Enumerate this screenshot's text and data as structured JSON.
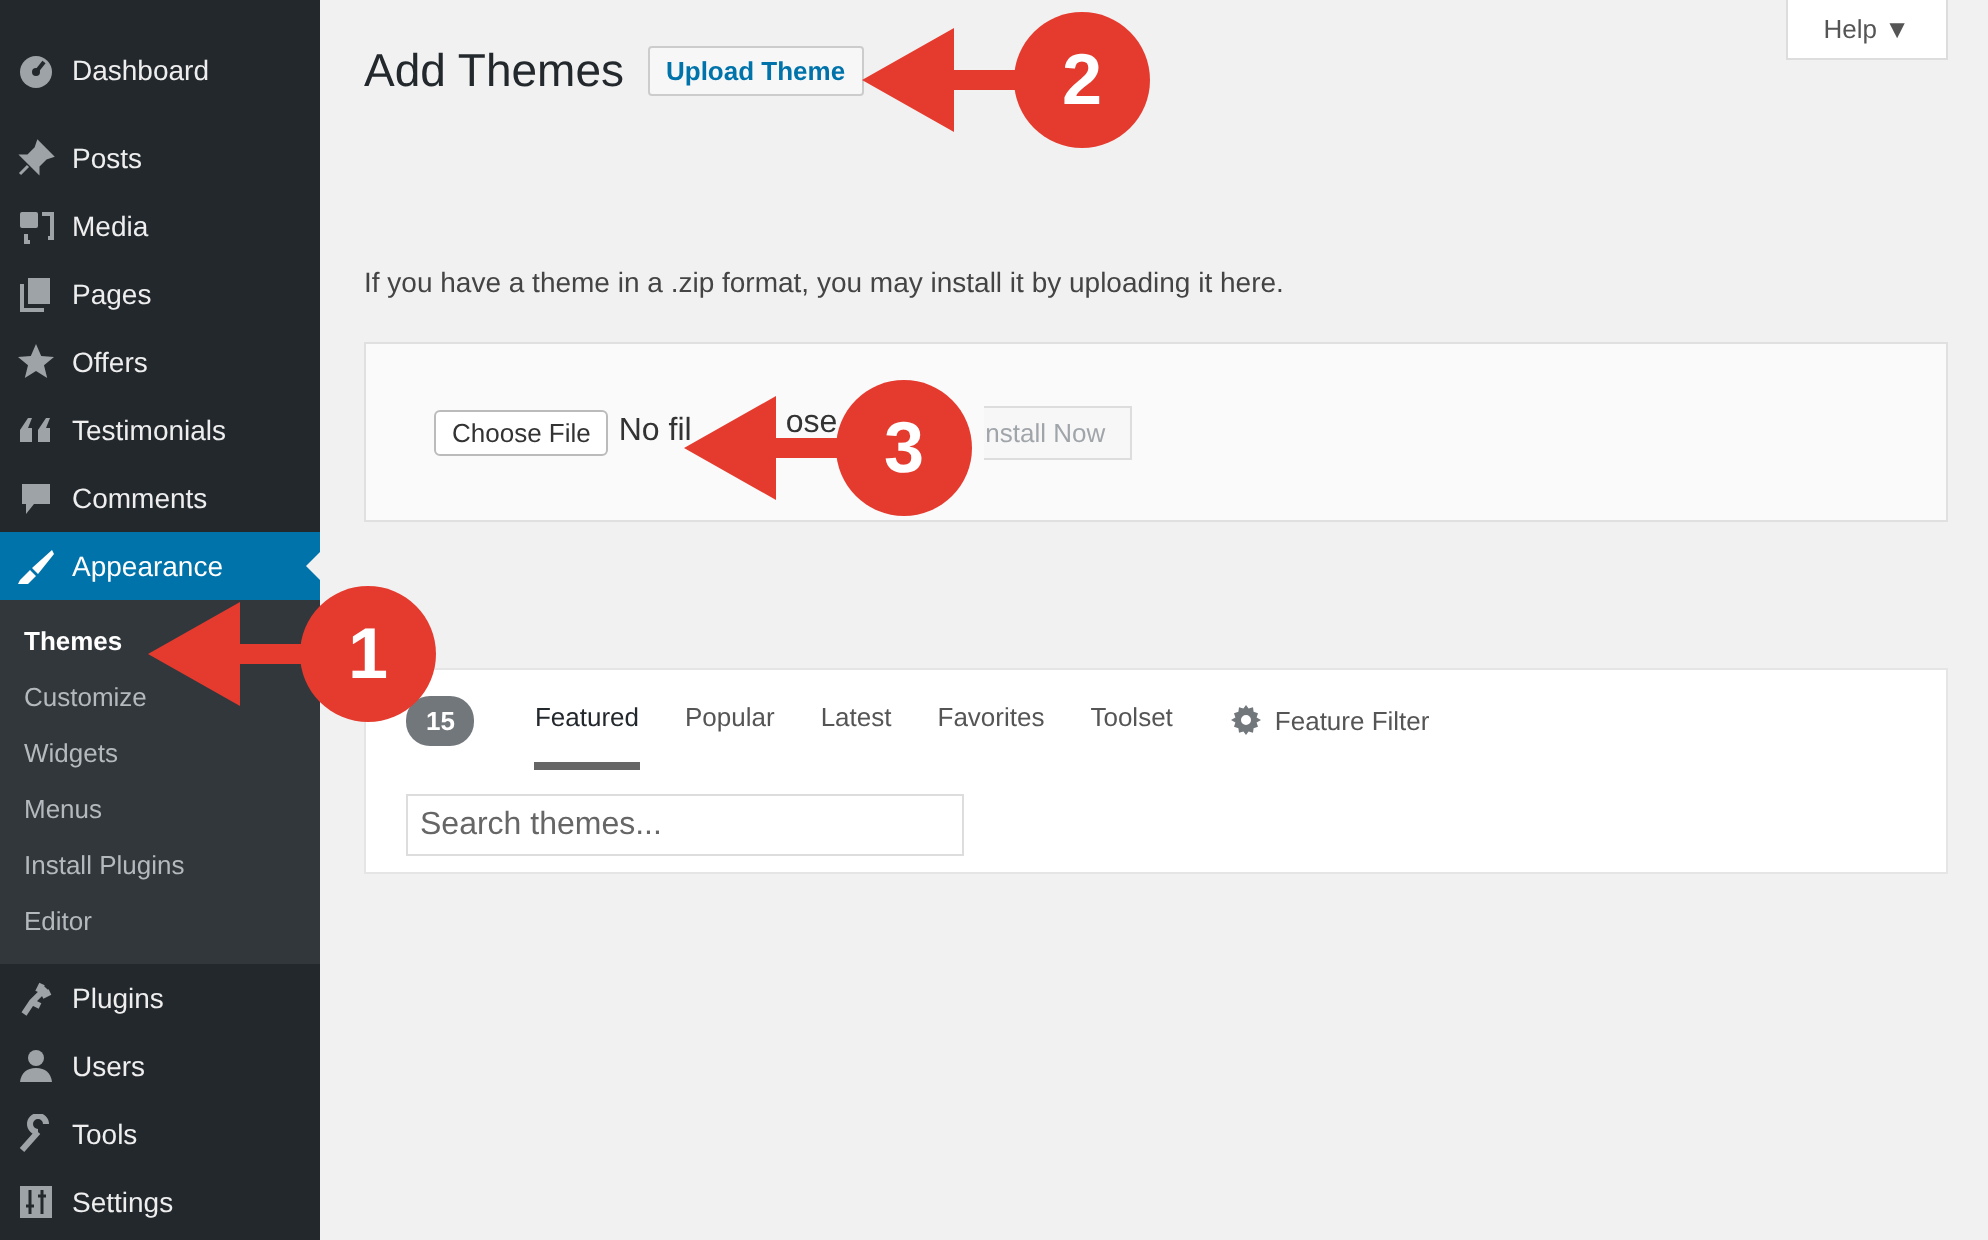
{
  "sidebar": {
    "items": [
      {
        "label": "Dashboard",
        "selected": false
      },
      {
        "label": "Posts",
        "selected": false
      },
      {
        "label": "Media",
        "selected": false
      },
      {
        "label": "Pages",
        "selected": false
      },
      {
        "label": "Offers",
        "selected": false
      },
      {
        "label": "Testimonials",
        "selected": false
      },
      {
        "label": "Comments",
        "selected": false
      },
      {
        "label": "Appearance",
        "selected": true,
        "children": [
          {
            "label": "Themes",
            "selected": true
          },
          {
            "label": "Customize",
            "selected": false
          },
          {
            "label": "Widgets",
            "selected": false
          },
          {
            "label": "Menus",
            "selected": false
          },
          {
            "label": "Install Plugins",
            "selected": false
          },
          {
            "label": "Editor",
            "selected": false
          }
        ]
      },
      {
        "label": "Plugins",
        "selected": false
      },
      {
        "label": "Users",
        "selected": false
      },
      {
        "label": "Tools",
        "selected": false
      },
      {
        "label": "Settings",
        "selected": false
      }
    ]
  },
  "header": {
    "title": "Add Themes",
    "upload_button": "Upload Theme",
    "help": "Help ▼"
  },
  "upload": {
    "description": "If you have a theme in a .zip format, you may install it by uploading it here.",
    "choose_button": "Choose File",
    "file_status": [
      "No fil",
      "ose"
    ],
    "install_button": {
      "label": "nstall Now",
      "disabled": true
    }
  },
  "filter": {
    "count": "15",
    "tabs": [
      {
        "label": "Featured",
        "selected": true
      },
      {
        "label": "Popular",
        "selected": false
      },
      {
        "label": "Latest",
        "selected": false
      },
      {
        "label": "Favorites",
        "selected": false
      },
      {
        "label": "Toolset",
        "selected": false
      }
    ],
    "feature_filter": "Feature Filter",
    "search": {
      "placeholder": "Search themes..."
    }
  },
  "callouts": [
    {
      "number": "1"
    },
    {
      "number": "2"
    },
    {
      "number": "3"
    }
  ]
}
